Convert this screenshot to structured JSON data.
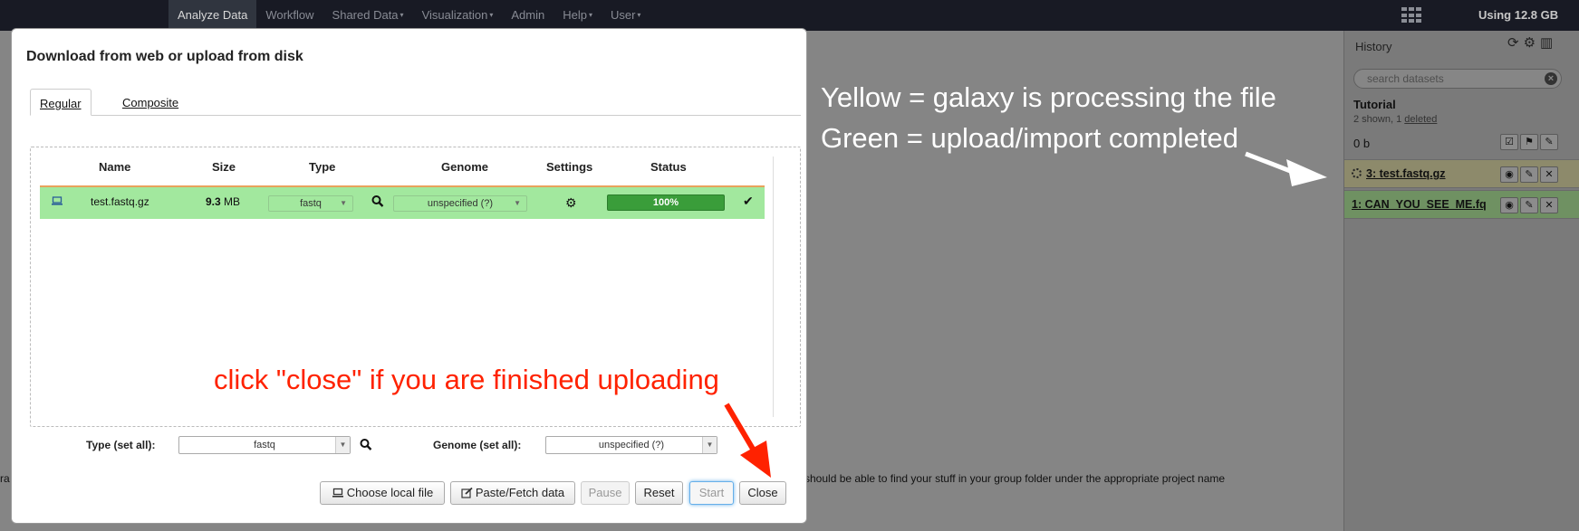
{
  "nav": {
    "items": [
      {
        "label": "Analyze Data",
        "active": true,
        "dropdown": false
      },
      {
        "label": "Workflow",
        "active": false,
        "dropdown": false
      },
      {
        "label": "Shared Data",
        "active": false,
        "dropdown": true
      },
      {
        "label": "Visualization",
        "active": false,
        "dropdown": true
      },
      {
        "label": "Admin",
        "active": false,
        "dropdown": false
      },
      {
        "label": "Help",
        "active": false,
        "dropdown": true
      },
      {
        "label": "User",
        "active": false,
        "dropdown": true
      }
    ],
    "caret": "▾",
    "usage": "Using 12.8 GB",
    "apps_icon": "grid-icon"
  },
  "background": {
    "left_text": "ra",
    "text": "should be able to find your stuff in your group folder under the appropriate project name"
  },
  "history": {
    "title": "History",
    "icons": [
      "refresh-icon",
      "gear-icon",
      "columns-icon"
    ],
    "search_placeholder": "search datasets",
    "name": "Tutorial",
    "meta_prefix": "2 shown, 1 ",
    "meta_link": "deleted",
    "size": "0 b",
    "datasets": [
      {
        "title": "3: test.fastq.gz",
        "state": "running",
        "color": "#8d8a6b"
      },
      {
        "title": "1: CAN_YOU_SEE_ME.fq",
        "state": "ok",
        "color": "#6f9162"
      }
    ]
  },
  "annotations": {
    "yellow": "Yellow = galaxy is processing the file",
    "green": "Green = upload/import completed",
    "close_hint": "click \"close\" if you are finished uploading"
  },
  "modal": {
    "title": "Download from web or upload from disk",
    "tabs": [
      "Regular",
      "Composite"
    ],
    "columns": [
      "Name",
      "Size",
      "Type",
      "Genome",
      "Settings",
      "Status"
    ],
    "row": {
      "name": "test.fastq.gz",
      "size_value": "9.3",
      "size_unit": "MB",
      "type": "fastq",
      "genome": "unspecified (?)",
      "progress_label": "100%",
      "progress": 1.0,
      "row_color": "#a2e89e"
    },
    "type_set_all_label": "Type (set all):",
    "type_set_all_value": "fastq",
    "genome_set_all_label": "Genome (set all):",
    "genome_set_all_value": "unspecified (?)",
    "buttons": {
      "choose_local": "Choose local file",
      "paste_fetch": "Paste/Fetch data",
      "pause": "Pause",
      "reset": "Reset",
      "start": "Start",
      "close": "Close"
    }
  },
  "colors": {
    "annotation_red": "#ff2200",
    "progress_green": "#3a9d3a"
  }
}
